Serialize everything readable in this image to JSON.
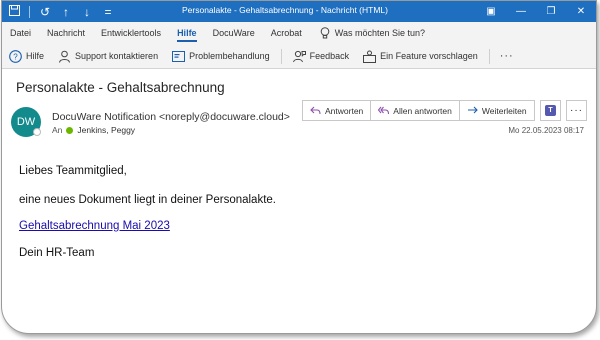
{
  "window": {
    "title": "Personalakte - Gehaltsabrechnung  -  Nachricht (HTML)"
  },
  "menu": {
    "tabs": [
      "Datei",
      "Nachricht",
      "Entwicklertools",
      "Hilfe",
      "DocuWare",
      "Acrobat"
    ],
    "active_tab": "Hilfe",
    "tell_me": "Was möchten Sie tun?"
  },
  "ribbon": {
    "help": "Hilfe",
    "contact_support": "Support kontaktieren",
    "troubleshoot": "Problembehandlung",
    "feedback": "Feedback",
    "suggest_feature": "Ein Feature vorschlagen",
    "more": "···"
  },
  "message": {
    "subject": "Personalakte - Gehaltsabrechnung",
    "avatar_initials": "DW",
    "sender": "DocuWare Notification <noreply@docuware.cloud>",
    "to_label": "An",
    "to_name": "Jenkins, Peggy",
    "date": "Mo 22.05.2023 08:17",
    "actions": {
      "reply": "Antworten",
      "reply_all": "Allen antworten",
      "forward": "Weiterleiten",
      "more": "···"
    }
  },
  "body": {
    "greeting": "Liebes Teammitglied,",
    "line": "eine neues Dokument liegt in deiner Personalakte.",
    "link": "Gehaltsabrechnung Mai 2023",
    "signature": "Dein HR-Team"
  },
  "colors": {
    "titlebar": "#1f6fc0",
    "accent": "#1a5fb0",
    "avatar": "#138a8c",
    "presence": "#6bb700",
    "link": "#1a0dab"
  }
}
